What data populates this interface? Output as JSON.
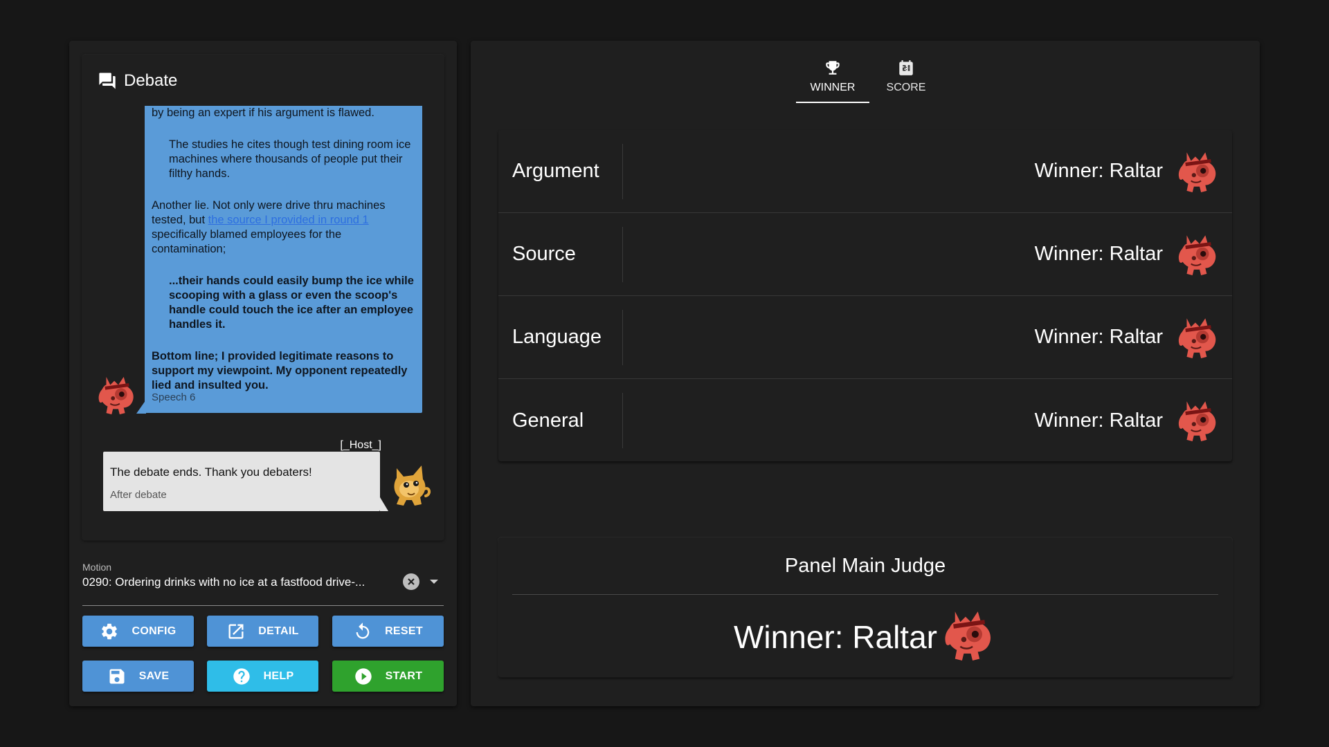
{
  "debate": {
    "title": "Debate",
    "speech": {
      "top_cut_line": "by being an expert if his argument is flawed.",
      "quote1": "The studies he cites though test dining room ice machines where thousands of people put their filthy hands.",
      "para2_before_link": "Another lie. Not only were drive thru machines tested, but ",
      "para2_link": "the source I provided in round 1",
      "para2_after_link": " specifically blamed employees for the contamination;",
      "quote2": "...their hands could easily bump the ice while scooping with a glass or even the scoop's handle could touch the ice after an employee handles it.",
      "para3": "Bottom line; I provided legitimate reasons to support my viewpoint. My opponent repeatedly lied and insulted you.",
      "tag": "Speech 6"
    },
    "host": {
      "name": "[_Host_]",
      "message": "The debate ends. Thank you debaters!",
      "tag": "After debate"
    }
  },
  "motion": {
    "label": "Motion",
    "value": "0290: Ordering drinks with no ice at a fastfood drive-..."
  },
  "buttons": {
    "config": "CONFIG",
    "detail": "DETAIL",
    "reset": "RESET",
    "save": "SAVE",
    "help": "HELP",
    "start": "START"
  },
  "tabs": [
    {
      "label": "WINNER",
      "icon": "trophy-icon",
      "active": true
    },
    {
      "label": "SCORE",
      "icon": "scoreboard-icon",
      "active": false
    }
  ],
  "categories": [
    {
      "name": "Argument",
      "winner": "Winner: Raltar"
    },
    {
      "name": "Source",
      "winner": "Winner: Raltar"
    },
    {
      "name": "Language",
      "winner": "Winner: Raltar"
    },
    {
      "name": "General",
      "winner": "Winner: Raltar"
    }
  ],
  "judge": {
    "title": "Panel Main Judge",
    "winner": "Winner: Raltar"
  },
  "colors": {
    "background": "#171717",
    "panel": "#1f1f1f",
    "speech_bubble": "#5a9bd8",
    "host_bubble": "#e4e4e4",
    "button_blue": "#4f93d6",
    "button_cyan": "#2fbde8",
    "button_green": "#2fa22d",
    "raltar_avatar": "#e2574c"
  }
}
